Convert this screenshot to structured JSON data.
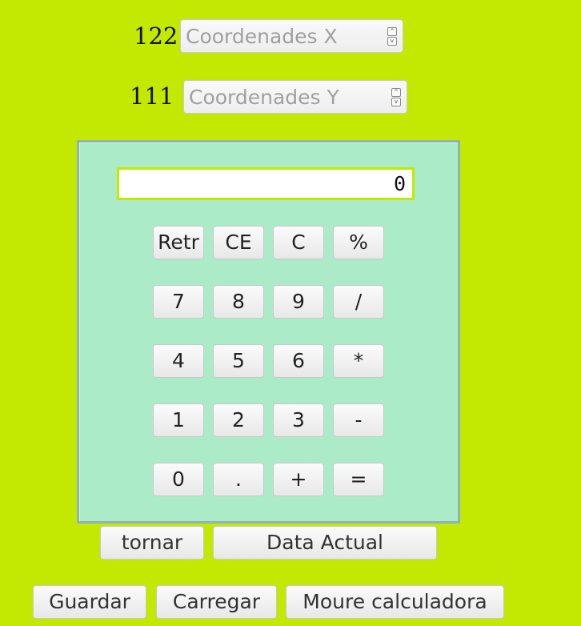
{
  "coords": {
    "x": {
      "value": "122",
      "placeholder": "Coordenades X"
    },
    "y": {
      "value": "111",
      "placeholder": "Coordenades Y"
    }
  },
  "spinner": {
    "up": "^",
    "down": "v"
  },
  "calculator": {
    "display": "0",
    "keys": [
      [
        "Retr",
        "CE",
        "C",
        "%"
      ],
      [
        "7",
        "8",
        "9",
        "/"
      ],
      [
        "4",
        "5",
        "6",
        "*"
      ],
      [
        "1",
        "2",
        "3",
        "-"
      ],
      [
        "0",
        ".",
        "+",
        "="
      ]
    ]
  },
  "actions": {
    "tornar": "tornar",
    "data_actual": "Data Actual",
    "guardar": "Guardar",
    "carregar": "Carregar",
    "moure": "Moure calculadora"
  }
}
